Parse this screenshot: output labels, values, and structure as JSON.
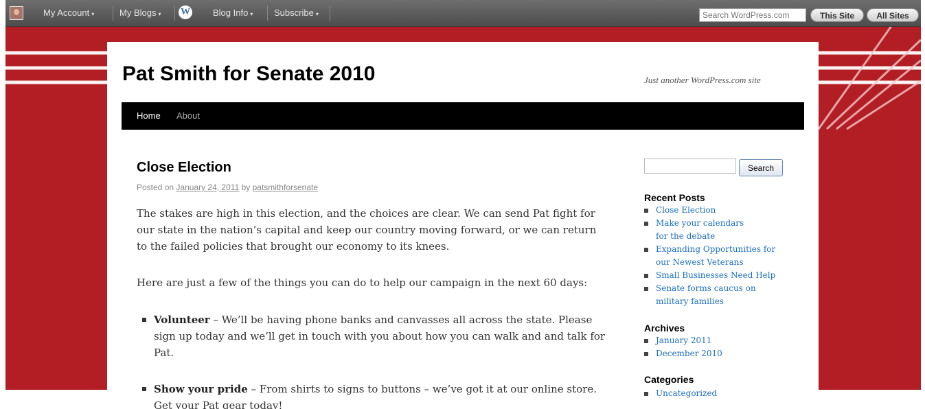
{
  "admin_bar": {
    "my_account": "My Account",
    "my_blogs": "My Blogs",
    "blog_info": "Blog Info",
    "subscribe": "Subscribe",
    "search_placeholder": "Search WordPress.com",
    "this_site": "This Site",
    "all_sites": "All Sites",
    "caret": "▾",
    "wp_logo_letter": "W"
  },
  "site": {
    "title": "Pat Smith for Senate 2010",
    "description": "Just another WordPress.com site"
  },
  "nav": {
    "items": [
      {
        "label": "Home"
      },
      {
        "label": "About"
      }
    ]
  },
  "post": {
    "title": "Close Election",
    "meta_prefix": "Posted on",
    "date": "January 24, 2011",
    "by": "by",
    "author": "patsmithforsenate",
    "paragraphs": [
      "The stakes are high in this election, and the choices are clear. We can send Pat fight for our state in the nation’s capital and keep our country moving forward, or we can return to the failed policies that brought our economy to its knees.",
      "Here are just a few of the things you can do to help our campaign in the next 60 days:"
    ],
    "list": [
      {
        "bold": "Volunteer",
        "text": " – We’ll be having phone banks and canvasses all across the state. Please sign up today and we’ll get in touch with you about how you can walk and and talk for Pat."
      },
      {
        "bold": "Show your pride",
        "text": " – From shirts to signs to buttons – we’ve got it at our online store. Get your Pat gear today!"
      }
    ]
  },
  "sidebar": {
    "search_button": "Search",
    "recent_posts": {
      "title": "Recent Posts",
      "items": [
        "Close Election",
        "Make your calendars for the debate",
        "Expanding Opportunities for our Newest Veterans",
        "Small Businesses Need Help",
        "Senate forms caucus on military families"
      ]
    },
    "archives": {
      "title": "Archives",
      "items": [
        "January 2011",
        "December 2010"
      ]
    },
    "categories": {
      "title": "Categories",
      "items": [
        "Uncategorized"
      ]
    }
  },
  "colors": {
    "background_red": "#b21e24",
    "admin_bar": "#5a5a5a",
    "nav_bar": "#000000",
    "link": "#1b6fbf"
  }
}
